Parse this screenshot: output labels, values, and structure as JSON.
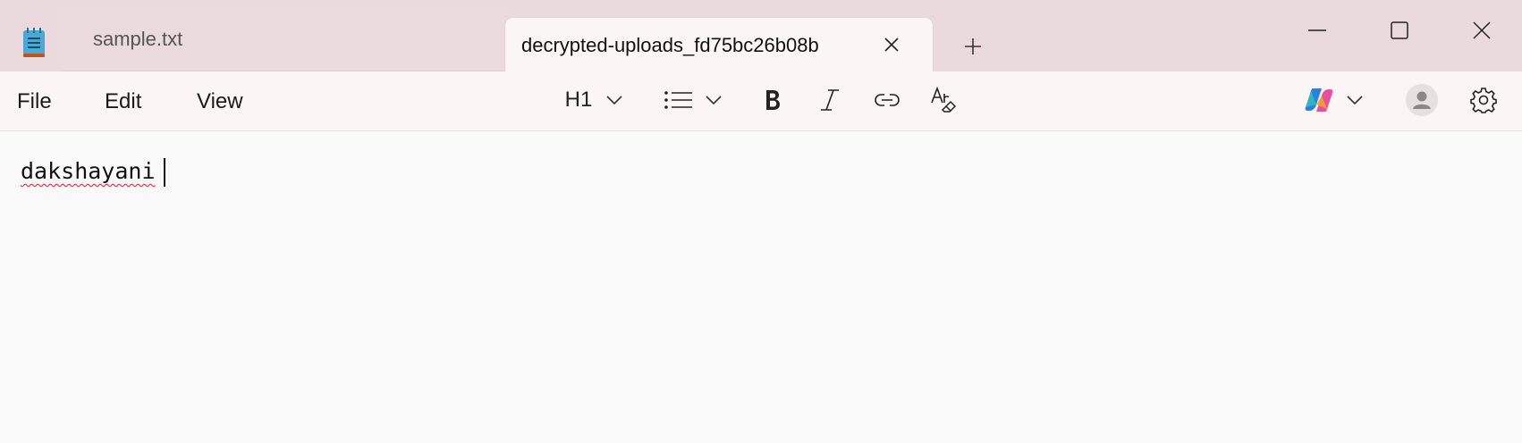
{
  "tabs": [
    {
      "label": "sample.txt",
      "active": false
    },
    {
      "label": "decrypted-uploads_fd75bc26b08b",
      "active": true
    }
  ],
  "menu": {
    "file": "File",
    "edit": "Edit",
    "view": "View"
  },
  "toolbar": {
    "heading_label": "H1"
  },
  "icons": {
    "app": "notepad-icon",
    "close_tab": "close-icon",
    "new_tab": "plus-icon",
    "minimize": "minimize-icon",
    "maximize": "maximize-icon",
    "close_window": "close-icon",
    "list": "bulleted-list-icon",
    "bold": "bold-icon",
    "italic": "italic-icon",
    "link": "link-icon",
    "clear_format": "clear-formatting-icon",
    "copilot": "copilot-icon",
    "account": "account-icon",
    "settings": "gear-icon"
  },
  "colors": {
    "titlebar": "#eadadd",
    "active_tab": "#fbf5f6",
    "editor": "#faf9f9",
    "spell_error": "#d42020"
  },
  "editor": {
    "content": "dakshayani"
  }
}
